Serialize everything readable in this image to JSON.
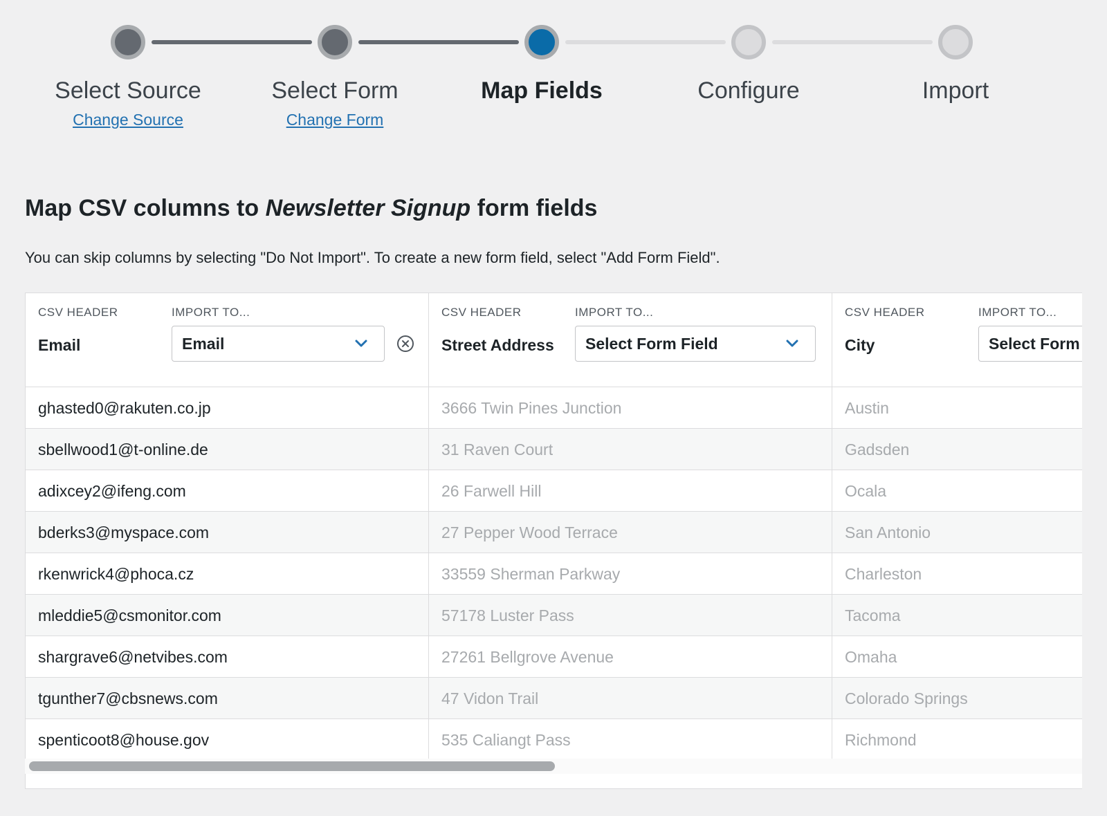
{
  "stepper": {
    "steps": [
      {
        "title": "Select Source",
        "link": "Change Source",
        "state": "done"
      },
      {
        "title": "Select Form",
        "link": "Change Form",
        "state": "done"
      },
      {
        "title": "Map Fields",
        "link": "",
        "state": "current"
      },
      {
        "title": "Configure",
        "link": "",
        "state": "todo"
      },
      {
        "title": "Import",
        "link": "",
        "state": "todo"
      }
    ]
  },
  "heading": {
    "prefix": "Map CSV columns to ",
    "form_name": "Newsletter Signup",
    "suffix": " form fields",
    "description": "You can skip columns by selecting \"Do Not Import\". To create a new form field, select \"Add Form Field\"."
  },
  "table": {
    "csv_header_label": "CSV HEADER",
    "import_to_label": "IMPORT TO...",
    "columns": [
      {
        "csv_header": "Email",
        "import_to": "Email",
        "rows": [
          "ghasted0@rakuten.co.jp",
          "sbellwood1@t-online.de",
          "adixcey2@ifeng.com",
          "bderks3@myspace.com",
          "rkenwrick4@phoca.cz",
          "mleddie5@csmonitor.com",
          "shargrave6@netvibes.com",
          "tgunther7@cbsnews.com",
          "spenticoot8@house.gov"
        ]
      },
      {
        "csv_header": "Street Address",
        "import_to": "Select Form Field",
        "rows": [
          "3666 Twin Pines Junction",
          "31 Raven Court",
          "26 Farwell Hill",
          "27 Pepper Wood Terrace",
          "33559 Sherman Parkway",
          "57178 Luster Pass",
          "27261 Bellgrove Avenue",
          "47 Vidon Trail",
          "535 Caliangt Pass"
        ]
      },
      {
        "csv_header": "City",
        "import_to": "Select Form Field",
        "rows": [
          "Austin",
          "Gadsden",
          "Ocala",
          "San Antonio",
          "Charleston",
          "Tacoma",
          "Omaha",
          "Colorado Springs",
          "Richmond"
        ]
      }
    ]
  },
  "colors": {
    "accent": "#0a6ba8",
    "link": "#2271b1",
    "step_done": "#646970",
    "step_todo": "#dcdcde",
    "muted_text": "#a7aaad"
  },
  "icons": {
    "chevron": "chevron-down-icon",
    "clear": "clear-circle-icon"
  }
}
